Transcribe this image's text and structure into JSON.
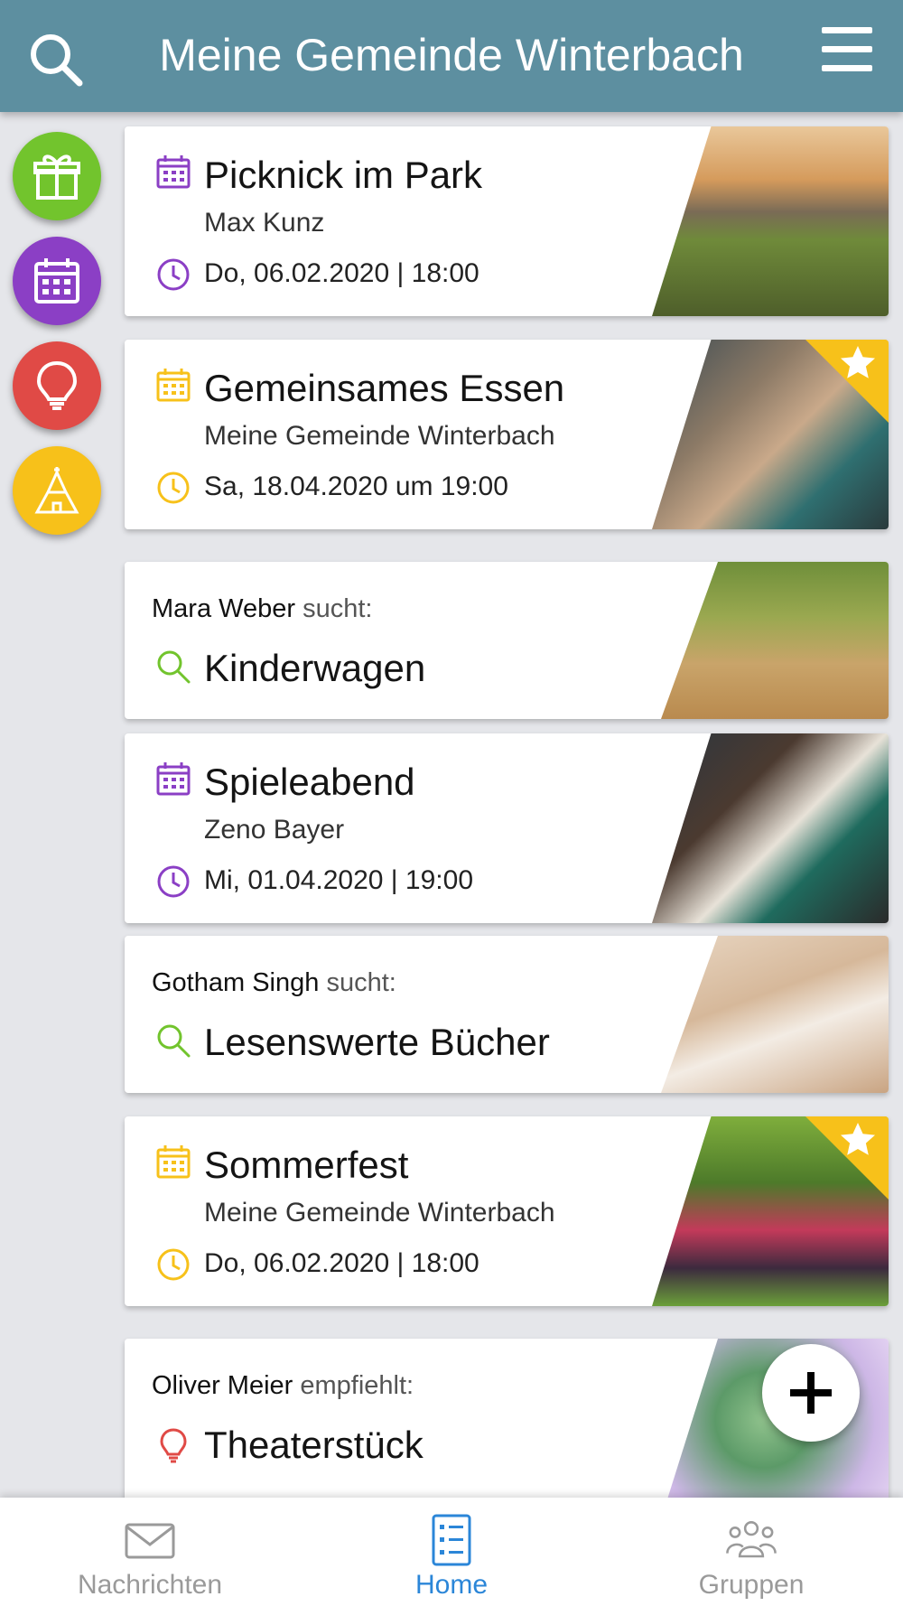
{
  "header": {
    "title": "Meine Gemeinde Winterbach"
  },
  "colors": {
    "header": "#5d8fa0",
    "green": "#72c42d",
    "purple": "#8b3fc5",
    "red": "#e04a46",
    "yellow": "#f7c11a",
    "active": "#2b86d8"
  },
  "side_buttons": [
    {
      "icon": "gift-icon",
      "color": "#72c42d"
    },
    {
      "icon": "calendar-icon",
      "color": "#8b3fc5"
    },
    {
      "icon": "lightbulb-icon",
      "color": "#e04a46"
    },
    {
      "icon": "church-icon",
      "color": "#f7c11a"
    }
  ],
  "feed": [
    {
      "type": "event",
      "title": "Picknick im Park",
      "organizer": "Max Kunz",
      "datetime": "Do, 06.02.2020 | 18:00",
      "color": "#8b3fc5",
      "featured": false
    },
    {
      "type": "event",
      "title": "Gemeinsames Essen",
      "organizer": "Meine Gemeinde Winterbach",
      "datetime": "Sa, 18.04.2020 um 19:00",
      "color": "#f7c11a",
      "featured": true
    },
    {
      "type": "request",
      "user": "Mara Weber",
      "verb": "sucht:",
      "title": "Kinderwagen"
    },
    {
      "type": "event",
      "title": "Spieleabend",
      "organizer": "Zeno Bayer",
      "datetime": "Mi, 01.04.2020 | 19:00",
      "color": "#8b3fc5",
      "featured": false
    },
    {
      "type": "request",
      "user": "Gotham Singh",
      "verb": "sucht:",
      "title": "Lesenswerte Bücher"
    },
    {
      "type": "event",
      "title": "Sommerfest",
      "organizer": "Meine Gemeinde Winterbach",
      "datetime": "Do, 06.02.2020 | 18:00",
      "color": "#f7c11a",
      "featured": true
    },
    {
      "type": "recommendation",
      "user": "Oliver Meier",
      "verb": "empfiehlt:",
      "title": "Theaterstück"
    }
  ],
  "bottom_nav": [
    {
      "label": "Nachrichten",
      "icon": "mail-icon",
      "active": false
    },
    {
      "label": "Home",
      "icon": "list-icon",
      "active": true
    },
    {
      "label": "Gruppen",
      "icon": "group-icon",
      "active": false
    }
  ]
}
